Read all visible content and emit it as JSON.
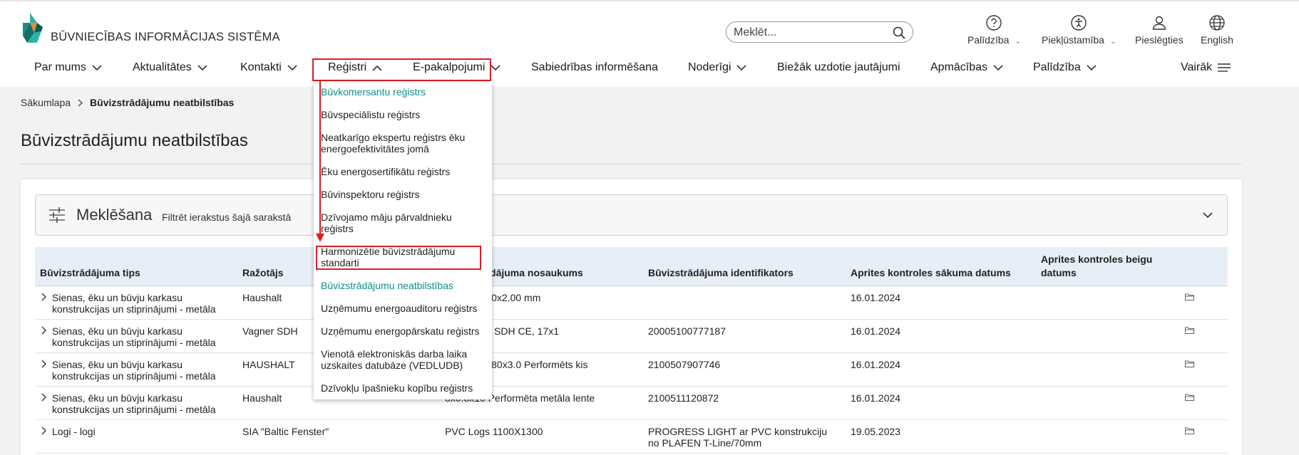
{
  "header": {
    "brand": "BŪVNIECĪBAS INFORMĀCIJAS SISTĒMA",
    "search_placeholder": "Meklēt...",
    "utilities": [
      {
        "label": "Palīdzība",
        "icon": "help-circle-icon"
      },
      {
        "label": "Piekļūstamība",
        "icon": "accessibility-icon"
      },
      {
        "label": "Pieslēgties",
        "icon": "user-icon"
      },
      {
        "label": "English",
        "icon": "globe-icon"
      }
    ]
  },
  "nav": {
    "items": [
      "Par mums",
      "Aktualitātes",
      "Kontakti",
      "Reģistri",
      "E-pakalpojumi",
      "Sabiedrības informēšana",
      "Noderīgi",
      "Biežāk uzdotie jautājumi",
      "Apmācības",
      "Palīdzība"
    ],
    "more": "Vairāk"
  },
  "breadcrumb": {
    "home": "Sākumlapa",
    "current": "Būvizstrādājumu neatbilstības"
  },
  "page_title": "Būvizstrādājumu neatbilstības",
  "filter": {
    "title": "Meklēšana",
    "subtitle": "Filtrēt ierakstus šajā sarakstā"
  },
  "table": {
    "headers": [
      "Būvizstrādājuma tips",
      "Ražotājs",
      "Būvizstrādājuma nosaukums",
      "Būvizstrādājuma identifikators",
      "Aprites kontroles sākuma datums",
      "Aprites kontroles beigu datums"
    ],
    "rows": [
      {
        "tips": "Sienas, ēku un būvju karkasu konstrukcijas un stiprinājumi - metāla",
        "razotajs": "Haushalt",
        "nosaukums": "T 60x60x20x2.00 mm",
        "identifikators": "",
        "sakums": "16.01.2024"
      },
      {
        "tips": "Sienas, ēku un būvju karkasu konstrukcijas un stiprinājumi - metāla",
        "razotajs": "Vagner SDH",
        "nosaukums": "kis Vagner SDH CE, 17x1",
        "identifikators": "20005100777187",
        "sakums": "16.01.2024"
      },
      {
        "tips": "Sienas, ēku un būvju karkasu konstrukcijas un stiprinājumi - metāla",
        "razotajs": "HAUSHALT",
        "nosaukums": "T 164x84x80x3.0 Performēts kis",
        "identifikators": "2100507907746",
        "sakums": "16.01.2024"
      },
      {
        "tips": "Sienas, ēku un būvju karkasu konstrukcijas un stiprinājumi - metāla",
        "razotajs": "Haushalt",
        "nosaukums": "8x0.8x10 Performēta metāla lente",
        "identifikators": "2100511120872",
        "sakums": "16.01.2024"
      },
      {
        "tips": "Logi - logi",
        "razotajs": "SIA \"Baltic Fenster\"",
        "nosaukums": "PVC Logs 1100X1300",
        "identifikators": "PROGRESS LIGHT ar PVC konstrukciju no PLAFEN T-Line/70mm",
        "sakums": "19.05.2023"
      }
    ]
  },
  "dropdown": {
    "items": [
      "Būvkomersantu reģistrs",
      "Būvspeciālistu reģistrs",
      "Neatkarīgo ekspertu reģistrs ēku energoefektivitātes jomā",
      "Ēku energosertifikātu reģistrs",
      "Būvinspektoru reģistrs",
      "Dzīvojamo māju pārvaldnieku reģistrs",
      "Harmonizētie būvizstrādājumu standarti",
      "Būvizstrādājumu neatbilstības",
      "Uzņēmumu energoauditoru reģistrs",
      "Uzņēmumu energopārskatu reģistrs",
      "Vienotā elektroniskās darba laika uzskaites datubāze (VEDLUDB)",
      "Dzīvokļu īpašnieku kopību reģistrs"
    ]
  },
  "colors": {
    "accent": "#0e8f8a",
    "annotation": "#e01b24",
    "table_header_bg": "#e7eef7"
  }
}
